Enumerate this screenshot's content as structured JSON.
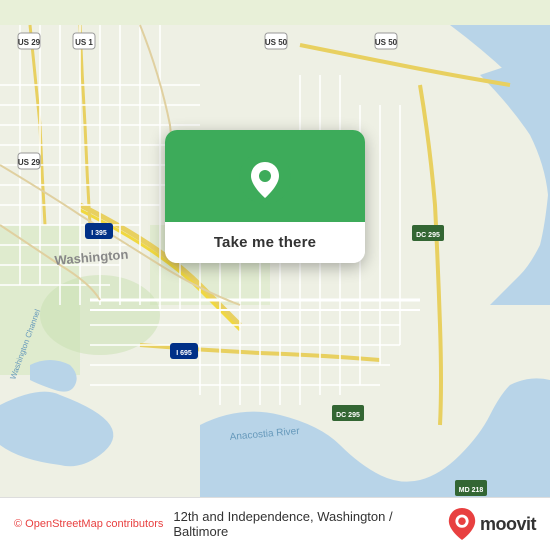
{
  "map": {
    "background_color": "#e8edd8",
    "center_lat": 38.88,
    "center_lng": -77.02
  },
  "popup": {
    "button_label": "Take me there",
    "icon_alt": "location pin"
  },
  "bottom_bar": {
    "attribution_prefix": "© ",
    "attribution_link": "OpenStreetMap contributors",
    "location_text": "12th and Independence, Washington / Baltimore",
    "logo_text": "moovit"
  }
}
